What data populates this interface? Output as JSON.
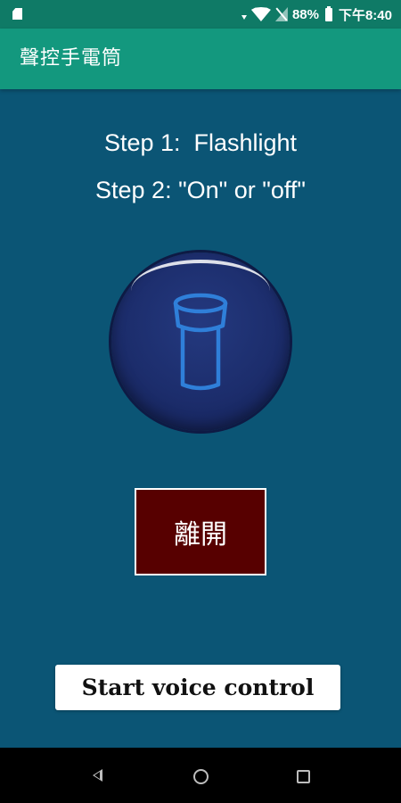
{
  "status_bar": {
    "battery_percent": "88%",
    "time": "下午8:40",
    "icons": [
      "sd-card-icon",
      "wifi-icon",
      "no-sim-icon",
      "battery-icon"
    ]
  },
  "app_bar": {
    "title": "聲控手電筒"
  },
  "main": {
    "step1": "Step 1:  Flashlight",
    "step2": "Step 2: \"On\" or \"off\"",
    "flashlight_button_icon": "flashlight-icon",
    "leave_button_label": "離開",
    "voice_button_label": "Start voice control"
  },
  "nav_bar": {
    "icons": [
      "back-icon",
      "home-icon",
      "recents-icon"
    ]
  },
  "colors": {
    "status_bar": "#0f7a66",
    "app_bar": "#13987e",
    "background": "#0b5575",
    "flash_button": "#1c2d6c",
    "flash_icon": "#2f7fd9",
    "leave_button": "#570000",
    "voice_button": "#ffffff"
  }
}
